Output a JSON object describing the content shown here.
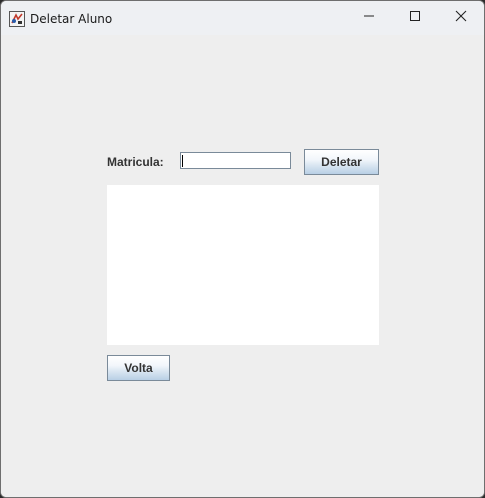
{
  "window": {
    "title": "Deletar Aluno",
    "icon": "java-app-icon"
  },
  "controls": {
    "minimize_icon": "minimize-icon",
    "maximize_icon": "maximize-icon",
    "close_icon": "close-icon"
  },
  "form": {
    "matricula_label": "Matricula:",
    "matricula_value": "",
    "deletar_label": "Deletar",
    "result_text": "",
    "volta_label": "Volta"
  }
}
